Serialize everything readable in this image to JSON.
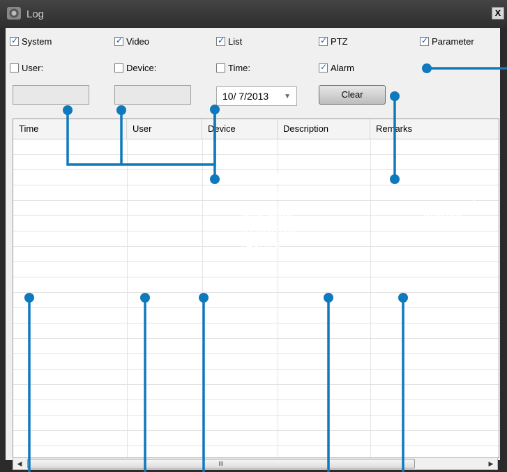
{
  "window": {
    "title": "Log",
    "close_label": "X"
  },
  "filters": {
    "row1": [
      {
        "label": "System",
        "checked": true
      },
      {
        "label": "Video",
        "checked": true
      },
      {
        "label": "List",
        "checked": true
      },
      {
        "label": "PTZ",
        "checked": true
      },
      {
        "label": "Parameter",
        "checked": true
      }
    ],
    "row2": [
      {
        "label": "User:",
        "checked": false
      },
      {
        "label": "Device:",
        "checked": false
      },
      {
        "label": "Time:",
        "checked": false
      },
      {
        "label": "Alarm",
        "checked": true
      }
    ]
  },
  "inputs": {
    "user_value": "",
    "device_value": "",
    "date_value": "10/ 7/2013"
  },
  "buttons": {
    "clear_label": "Clear"
  },
  "table": {
    "columns": [
      "Time",
      "User",
      "Device",
      "Description",
      "Remarks"
    ],
    "rows": []
  },
  "scrollbar": {
    "thumb_glyph": "III"
  },
  "annotations": {
    "time_date": {
      "head": "Time/Date",
      "lines": [
        "Enter time",
        "and date",
        "to narrow",
        "results"
      ]
    },
    "clear": {
      "head": "Clear",
      "lines": [
        "Clear log",
        "entries"
      ]
    }
  },
  "colors": {
    "callout_line": "#0f79bd",
    "callout_text": "#ffffff"
  }
}
